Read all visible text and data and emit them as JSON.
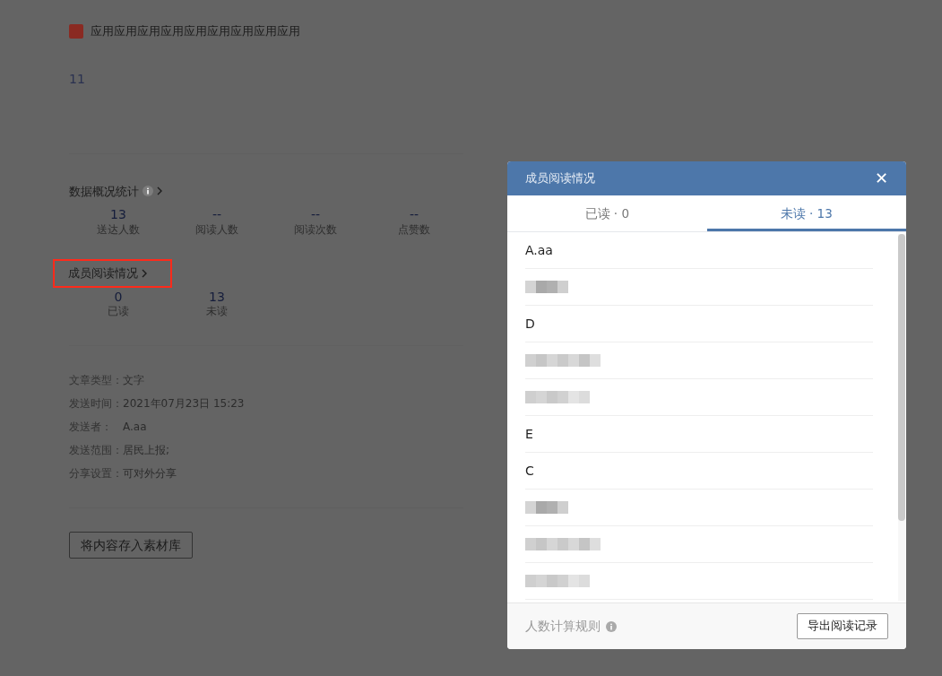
{
  "app_title": "应用应用应用应用应用应用应用应用应用",
  "content": "11",
  "overview": {
    "title": "数据概况统计",
    "stats": [
      {
        "value": "13",
        "label": "送达人数"
      },
      {
        "value": "--",
        "label": "阅读人数"
      },
      {
        "value": "--",
        "label": "阅读次数"
      },
      {
        "value": "--",
        "label": "点赞数"
      }
    ]
  },
  "member_reading": {
    "title": "成员阅读情况",
    "highlighted": true,
    "stats": [
      {
        "value": "0",
        "label": "已读"
      },
      {
        "value": "13",
        "label": "未读"
      }
    ]
  },
  "info": [
    {
      "label": "文章类型：",
      "value": "文字"
    },
    {
      "label": "发送时间：",
      "value": "2021年07月23日 15:23"
    },
    {
      "label": "发送者：",
      "value": "A.aa"
    },
    {
      "label": "发送范围：",
      "value": "居民上报;"
    },
    {
      "label": "分享设置：",
      "value": "可对外分享"
    }
  ],
  "save_button": "将内容存入素材库",
  "modal": {
    "title": "成员阅读情况",
    "close": "✕",
    "tabs": [
      {
        "label": "已读 · 0",
        "selected": false
      },
      {
        "label": "未读 · 13",
        "selected": true
      }
    ],
    "members": [
      {
        "kind": "name",
        "name": "A.aa"
      },
      {
        "kind": "redacted"
      },
      {
        "kind": "name",
        "name": "D"
      },
      {
        "kind": "redacted"
      },
      {
        "kind": "redacted"
      },
      {
        "kind": "name",
        "name": "E"
      },
      {
        "kind": "name",
        "name": "C"
      },
      {
        "kind": "redacted"
      },
      {
        "kind": "redacted"
      },
      {
        "kind": "redacted"
      }
    ],
    "rule_label": "人数计算规则",
    "export_button": "导出阅读记录"
  }
}
